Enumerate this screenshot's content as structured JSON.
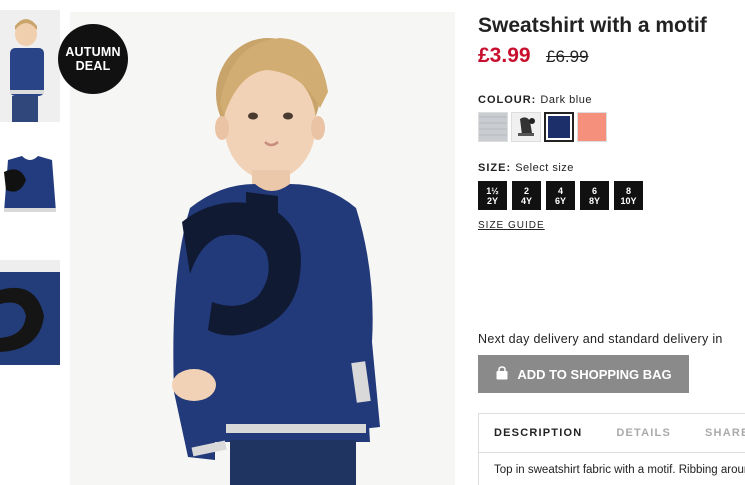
{
  "badge": {
    "line1": "AUTUMN",
    "line2": "DEAL"
  },
  "product": {
    "title": "Sweatshirt with a motif",
    "price": "£3.99",
    "old_price": "£6.99"
  },
  "colour": {
    "label": "COLOUR:",
    "selected": "Dark blue",
    "swatches": [
      {
        "name": "grey-melange",
        "color": "#c9cdd2",
        "selected": false
      },
      {
        "name": "print",
        "color": "#e6e6e6",
        "selected": false
      },
      {
        "name": "dark-blue",
        "color": "#1d2f6b",
        "selected": true
      },
      {
        "name": "coral",
        "color": "#f4907c",
        "selected": false
      }
    ]
  },
  "size": {
    "label": "SIZE:",
    "placeholder": "Select size",
    "options": [
      {
        "line1": "1½",
        "line2": "2Y"
      },
      {
        "line1": "2",
        "line2": "4Y"
      },
      {
        "line1": "4",
        "line2": "6Y"
      },
      {
        "line1": "6",
        "line2": "8Y"
      },
      {
        "line1": "8",
        "line2": "10Y"
      }
    ],
    "guide_link": "SIZE GUIDE"
  },
  "delivery_text": "Next day delivery and standard delivery in",
  "add_to_bag": "ADD TO SHOPPING BAG",
  "tabs": [
    {
      "label": "DESCRIPTION",
      "active": true
    },
    {
      "label": "DETAILS",
      "active": false
    },
    {
      "label": "SHARE",
      "active": false
    }
  ],
  "description_text": "Top in sweatshirt fabric with a motif. Ribbing around"
}
